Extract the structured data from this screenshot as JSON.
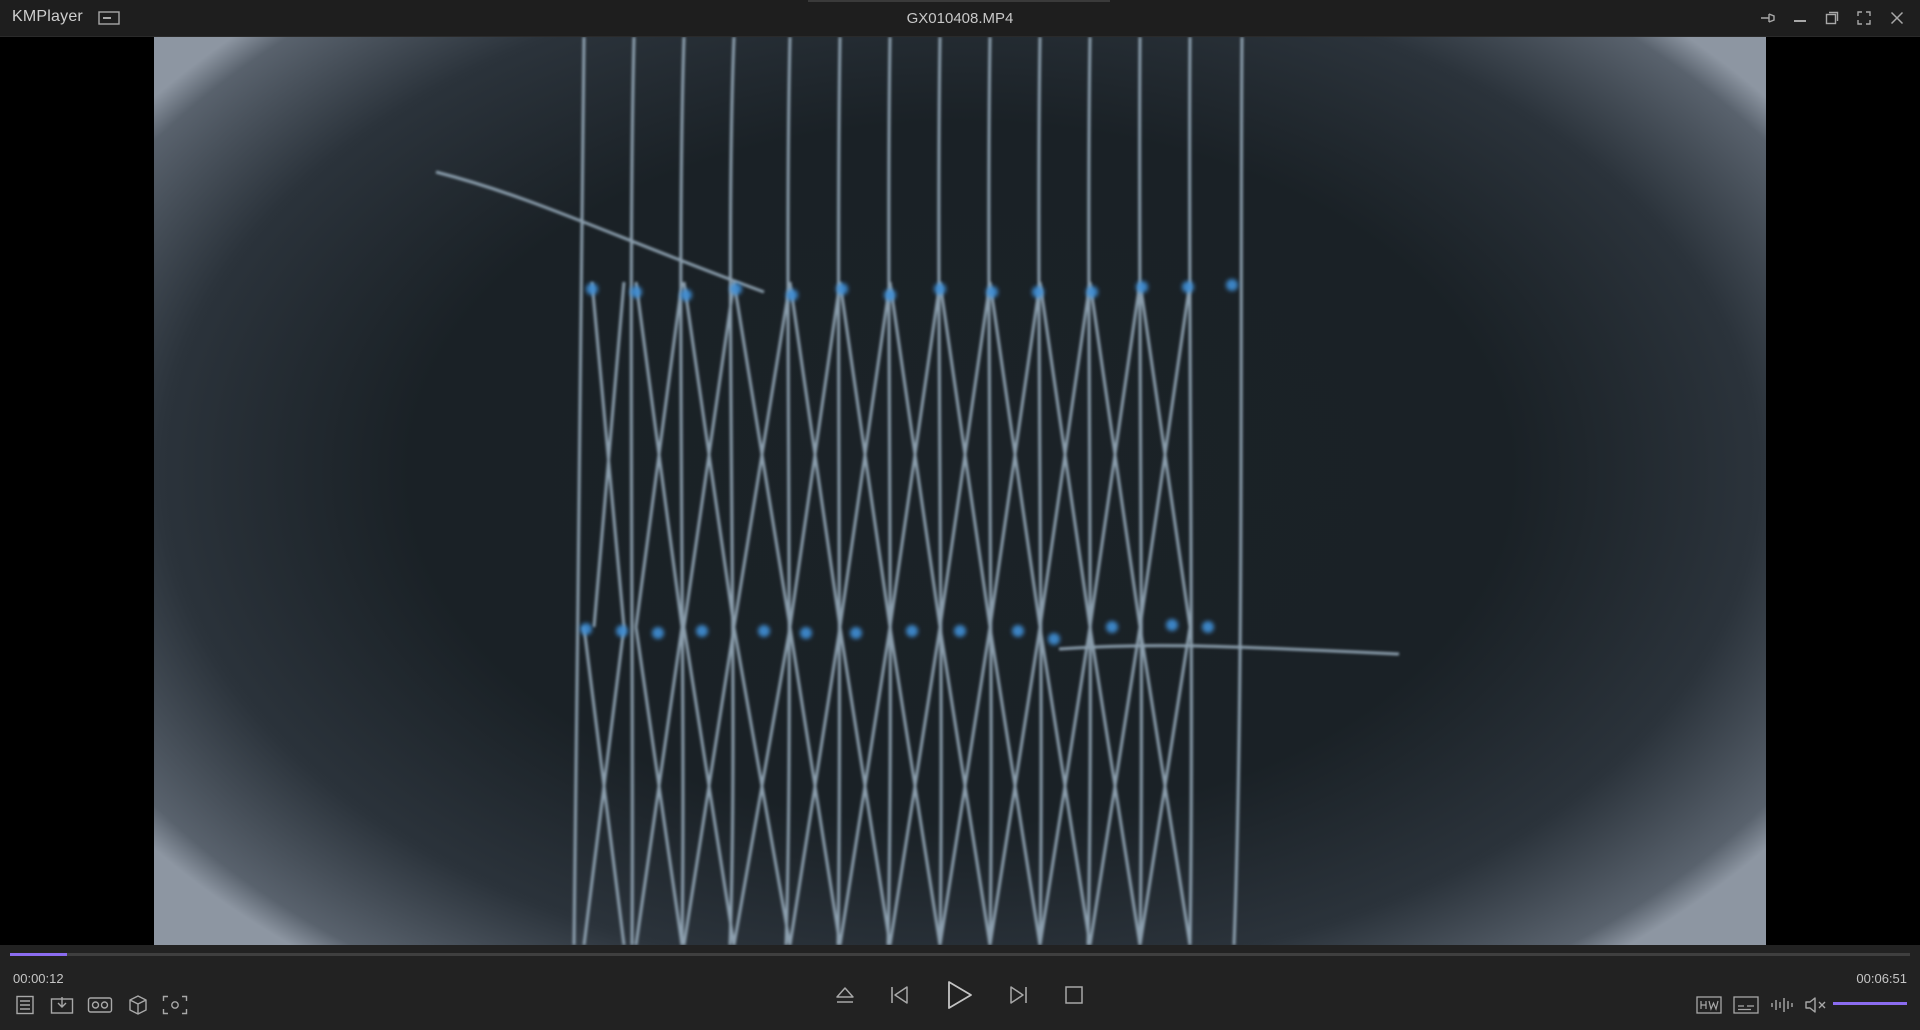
{
  "app": {
    "name": "KMPlayer"
  },
  "window": {
    "title": "GX010408.MP4"
  },
  "playback": {
    "current_time": "00:00:12",
    "total_time": "00:06:51",
    "progress_fraction": 0.03,
    "volume_fraction": 1.0,
    "muted": true
  },
  "icons": {
    "mode": "mini-mode-icon",
    "pin": "pin-icon",
    "minimize": "minimize-icon",
    "restore": "restore-icon",
    "fullscreen": "fullscreen-icon",
    "close": "close-icon",
    "playlist": "playlist-icon",
    "download": "download-icon",
    "vr": "vr-icon",
    "three_d": "3d-cube-icon",
    "capture": "screen-capture-icon",
    "eject": "eject-icon",
    "previous": "previous-icon",
    "play": "play-icon",
    "next": "next-icon",
    "stop": "stop-icon",
    "hw_decoder": "hw-decoder-icon",
    "subtitles": "subtitles-icon",
    "equalizer": "equalizer-icon",
    "mute": "speaker-muted-icon"
  },
  "colors": {
    "accent": "#8b6cf0",
    "titlebar_bg": "#1e1e1e",
    "controls_bg": "#222222"
  }
}
